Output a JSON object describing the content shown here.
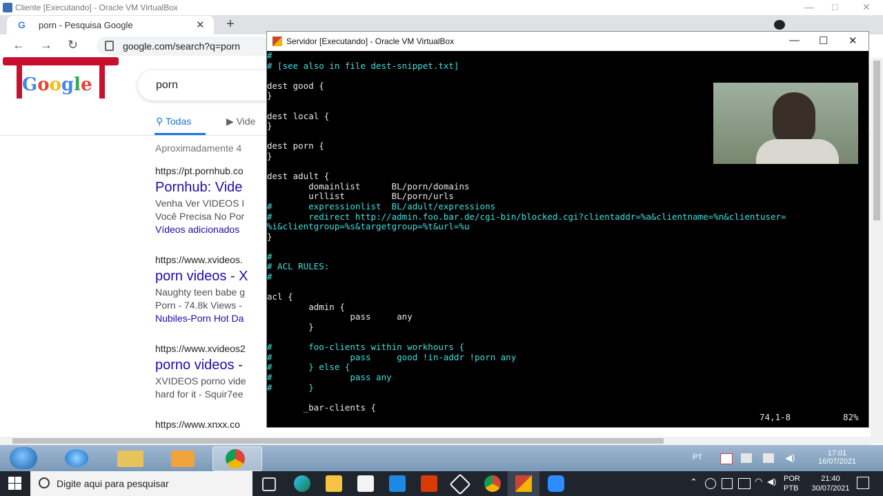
{
  "outer_window": {
    "title": "Cliente [Executando] - Oracle VM VirtualBox",
    "controls": [
      "—",
      "□",
      "✕"
    ]
  },
  "browser": {
    "tab_label": "porn - Pesquisa Google",
    "tab_close": "✕",
    "new_tab": "+",
    "url": "google.com/search?q=porn",
    "nav": {
      "back": "←",
      "forward": "→",
      "reload": "↻"
    }
  },
  "google": {
    "logo": "Google",
    "query": "porn",
    "tab_all": "Todas",
    "tab_videos": "Vide",
    "result_count": "Aproximadamente 4",
    "results": [
      {
        "url": "https://pt.pornhub.co",
        "title": "Pornhub: Vide",
        "lines": [
          "Venha Ver VIDEOS I",
          "Você Precisa No Por"
        ],
        "link": "Vídeos adicionados"
      },
      {
        "url": "https://www.xvideos.",
        "title": "porn videos - X",
        "lines": [
          "Naughty teen babe g",
          "Porn - 74.8k Views -"
        ],
        "link": "Nubiles-Porn Hot Da"
      },
      {
        "url": "https://www.xvideos2",
        "title": "porno videos -",
        "lines": [
          "XVIDEOS porno vide",
          "hard for it - Squir7ee"
        ],
        "link": ""
      },
      {
        "url": "https://www.xnxx.co",
        "title": "",
        "lines": [],
        "link": ""
      }
    ]
  },
  "inner_window": {
    "title": "Servidor [Executando] - Oracle VM VirtualBox",
    "controls": [
      "—",
      "☐",
      "✕"
    ]
  },
  "terminal": {
    "lines": [
      {
        "text": "#",
        "color": "cyan"
      },
      {
        "text": "# [see also in file dest-snippet.txt]",
        "color": "cyan"
      },
      {
        "text": "",
        "color": "white"
      },
      {
        "text": "dest good {",
        "color": "white"
      },
      {
        "text": "}",
        "color": "white"
      },
      {
        "text": "",
        "color": "white"
      },
      {
        "text": "dest local {",
        "color": "white"
      },
      {
        "text": "}",
        "color": "white"
      },
      {
        "text": "",
        "color": "white"
      },
      {
        "text": "dest porn {",
        "color": "white"
      },
      {
        "text": "}",
        "color": "white"
      },
      {
        "text": "",
        "color": "white"
      },
      {
        "text": "dest adult {",
        "color": "white"
      },
      {
        "text": "        domainlist      BL/porn/domains",
        "color": "white"
      },
      {
        "text": "        urllist         BL/porn/urls",
        "color": "white"
      },
      {
        "text": "#       expressionlist  BL/adult/expressions",
        "color": "cyan"
      },
      {
        "text": "#       redirect http://admin.foo.bar.de/cgi-bin/blocked.cgi?clientaddr=%a&clientname=%n&clientuser=",
        "color": "cyan"
      },
      {
        "text": "%i&clientgroup=%s&targetgroup=%t&url=%u",
        "color": "cyan"
      },
      {
        "text": "}",
        "color": "white"
      },
      {
        "text": "",
        "color": "white"
      },
      {
        "text": "#",
        "color": "cyan"
      },
      {
        "text": "# ACL RULES:",
        "color": "cyan"
      },
      {
        "text": "#",
        "color": "cyan"
      },
      {
        "text": "",
        "color": "white"
      },
      {
        "text": "acl {",
        "color": "white"
      },
      {
        "text": "        admin {",
        "color": "white"
      },
      {
        "text": "                pass     any",
        "color": "white"
      },
      {
        "text": "        }",
        "color": "white"
      },
      {
        "text": "",
        "color": "white"
      },
      {
        "text": "#       foo-clients within workhours {",
        "color": "cyan"
      },
      {
        "text": "#               pass     good !in-addr !porn any",
        "color": "cyan"
      },
      {
        "text": "#       } else {",
        "color": "cyan"
      },
      {
        "text": "#               pass any",
        "color": "cyan"
      },
      {
        "text": "#       }",
        "color": "cyan"
      },
      {
        "text": "",
        "color": "white"
      },
      {
        "text": "       _bar-clients {",
        "color": "white"
      }
    ],
    "status_position": "74,1-8",
    "status_percent": "82%"
  },
  "guest_taskbar": {
    "lang": "PT",
    "time": "17:01",
    "date": "16/07/2021"
  },
  "host_taskbar": {
    "search_placeholder": "Digite aqui para pesquisar",
    "lang_top": "POR",
    "lang_bottom": "PTB",
    "time": "21:40",
    "date": "30/07/2021"
  },
  "colors": {
    "terminal_cyan": "#3ee0e0",
    "link_blue": "#1a0dab",
    "google_blue": "#1a73e8"
  }
}
